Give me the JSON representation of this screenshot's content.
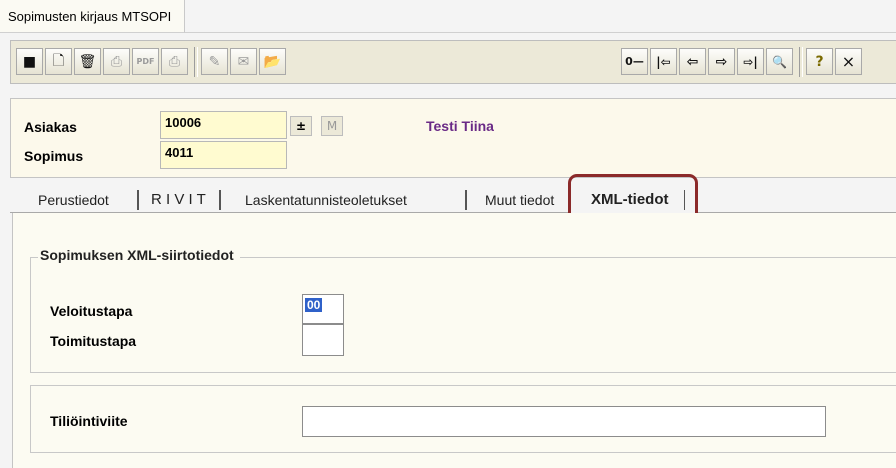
{
  "window": {
    "tab_title": "Sopimusten kirjaus MTSOPI"
  },
  "toolbar": {
    "buttons": [
      {
        "icon": "save-icon",
        "glyph": "■"
      },
      {
        "icon": "new-document-icon",
        "glyph": "🗋"
      },
      {
        "icon": "delete-icon",
        "glyph": "🗑"
      },
      {
        "icon": "print-icon",
        "glyph": "⎙"
      },
      {
        "icon": "pdf-icon",
        "glyph": "PDF"
      },
      {
        "icon": "print-preview-icon",
        "glyph": "⎙"
      },
      {
        "icon": "edit-icon",
        "glyph": "✎"
      },
      {
        "icon": "note-icon",
        "glyph": "✉"
      },
      {
        "icon": "open-folder-icon",
        "glyph": "📂"
      },
      {
        "icon": "key-icon",
        "glyph": "0—"
      },
      {
        "icon": "first-record-icon",
        "glyph": "|⇦"
      },
      {
        "icon": "previous-record-icon",
        "glyph": "⇦"
      },
      {
        "icon": "next-record-icon",
        "glyph": "⇨"
      },
      {
        "icon": "last-record-icon",
        "glyph": "⇨|"
      },
      {
        "icon": "search-binoculars-icon",
        "glyph": "🔍"
      },
      {
        "icon": "help-icon",
        "glyph": "?"
      },
      {
        "icon": "close-icon",
        "glyph": "×"
      }
    ]
  },
  "header": {
    "customer_label": "Asiakas",
    "customer_value": "10006",
    "customer_name": "Testi Tiina",
    "contract_label": "Sopimus",
    "contract_value": "4011",
    "down_button": "±",
    "m_button": "M"
  },
  "tabs": [
    {
      "label": "Perustiedot"
    },
    {
      "label": "R I V I T"
    },
    {
      "label": "Laskentatunnisteoletukset"
    },
    {
      "label": "Muut tiedot"
    },
    {
      "label": "XML-tiedot"
    }
  ],
  "xml_section": {
    "title": "Sopimuksen XML-siirtotiedot",
    "veloitustapa_label": "Veloitustapa",
    "veloitustapa_value": "00",
    "toimitustapa_label": "Toimitustapa",
    "toimitustapa_value": ""
  },
  "account_section": {
    "label": "Tiliöintiviite",
    "value": ""
  },
  "colors": {
    "toolbar_bg": "#ece9d8",
    "header_bg": "#fcf9eb",
    "input_bg": "#fffbd0",
    "customer_name": "#6a2a86",
    "active_tab_highlight": "#8b2a2a"
  }
}
